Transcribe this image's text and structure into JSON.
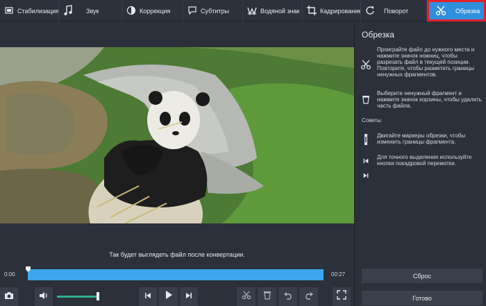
{
  "toolbar": {
    "tabs": [
      {
        "label": "Стабилизация",
        "icon": "stabilization-icon"
      },
      {
        "label": "Звук",
        "icon": "music-note-icon"
      },
      {
        "label": "Коррекция",
        "icon": "color-correction-icon"
      },
      {
        "label": "Субтитры",
        "icon": "subtitles-icon"
      },
      {
        "label": "Водяной знак",
        "icon": "watermark-icon"
      },
      {
        "label": "Кадрирование",
        "icon": "crop-icon"
      },
      {
        "label": "Поворот",
        "icon": "rotate-icon"
      },
      {
        "label": "Обрезка",
        "icon": "scissors-icon",
        "active": true
      }
    ]
  },
  "player": {
    "caption": "Так будет выглядеть файл после конвертации.",
    "time_start": "0:00",
    "time_end": "00:27",
    "volume_level": 0.95
  },
  "panel": {
    "title": "Обрезка",
    "instruction_cut": "Проиграйте файл до нужного места и нажмите значок ножниц, чтобы разрезать файл в текущей позиции. Повторите, чтобы разметить границы ненужных фрагментов.",
    "instruction_delete": "Выберите ненужный фрагмент и нажмите значок корзины, чтобы удалить часть файла.",
    "tips_heading": "Советы",
    "tip_markers": "Двигайте маркеры обрезки, чтобы изменить границы фрагмента.",
    "tip_frames": "Для точного выделения используйте кнопки покадровой перемотки.",
    "reset_label": "Сброс",
    "done_label": "Готово"
  },
  "colors": {
    "accent": "#2f8fdd",
    "highlight": "#e3202a",
    "timeline": "#3ba6ea",
    "volume": "#2fae8d"
  }
}
